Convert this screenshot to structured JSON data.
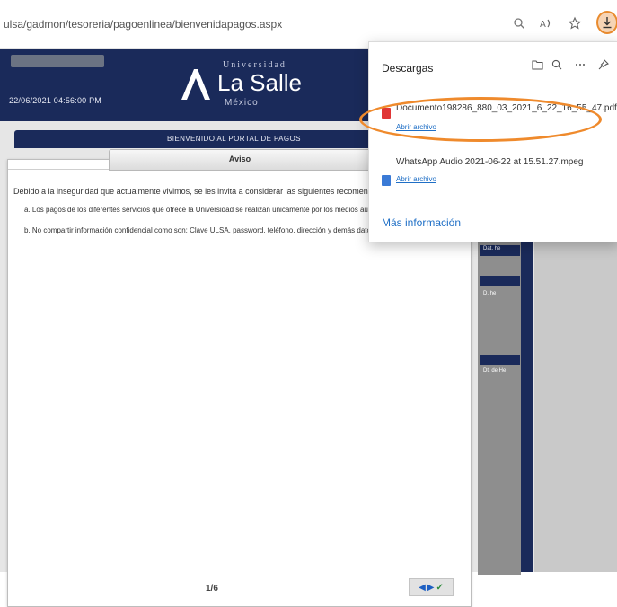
{
  "browser": {
    "url": "ulsa/gadmon/tesoreria/pagoenlinea/bienvenidapagos.aspx",
    "icons": [
      "zoom-icon",
      "read-aloud-icon",
      "favorites-icon",
      "download-icon"
    ]
  },
  "header": {
    "datetime": "22/06/2021 04:56:00 PM",
    "logo": {
      "univ": "Universidad",
      "name": "La Salle",
      "country": "México"
    },
    "portal_text": "BIENVENIDO AL PORTAL DE PAGOS"
  },
  "dialog": {
    "title": "Aviso",
    "intro": "Debido a la inseguridad que actualmente vivimos, se les invita a considerar las siguientes recomendaciones:",
    "item_a": "a. Los pagos de los diferentes servicios que ofrece la Universidad se realizan únicamente por los medios autorizados.",
    "item_b": "b. No compartir información confidencial como son: Clave ULSA, password, teléfono, dirección y demás datos personales.",
    "pager": "1/6",
    "nav_prev": "◀",
    "nav_next": "▶",
    "nav_ok": "✓"
  },
  "right_column": {
    "labels": [
      "Dat. he",
      "D. he",
      "Dt. de He"
    ]
  },
  "downloads": {
    "title": "Descargas",
    "tools": [
      "folder-icon",
      "search-icon",
      "more-icon",
      "pin-icon"
    ],
    "items": [
      {
        "name": "Documento198286_880_03_2021_6_22_16_55_47.pdf",
        "action": "Abrir archivo"
      },
      {
        "name": "WhatsApp Audio 2021-06-22 at 15.51.27.mpeg",
        "action": "Abrir archivo"
      }
    ],
    "more_info": "Más información"
  },
  "colors": {
    "navy": "#1a2a5a",
    "highlight": "#ef8a2c",
    "link": "#1f6fc6"
  }
}
